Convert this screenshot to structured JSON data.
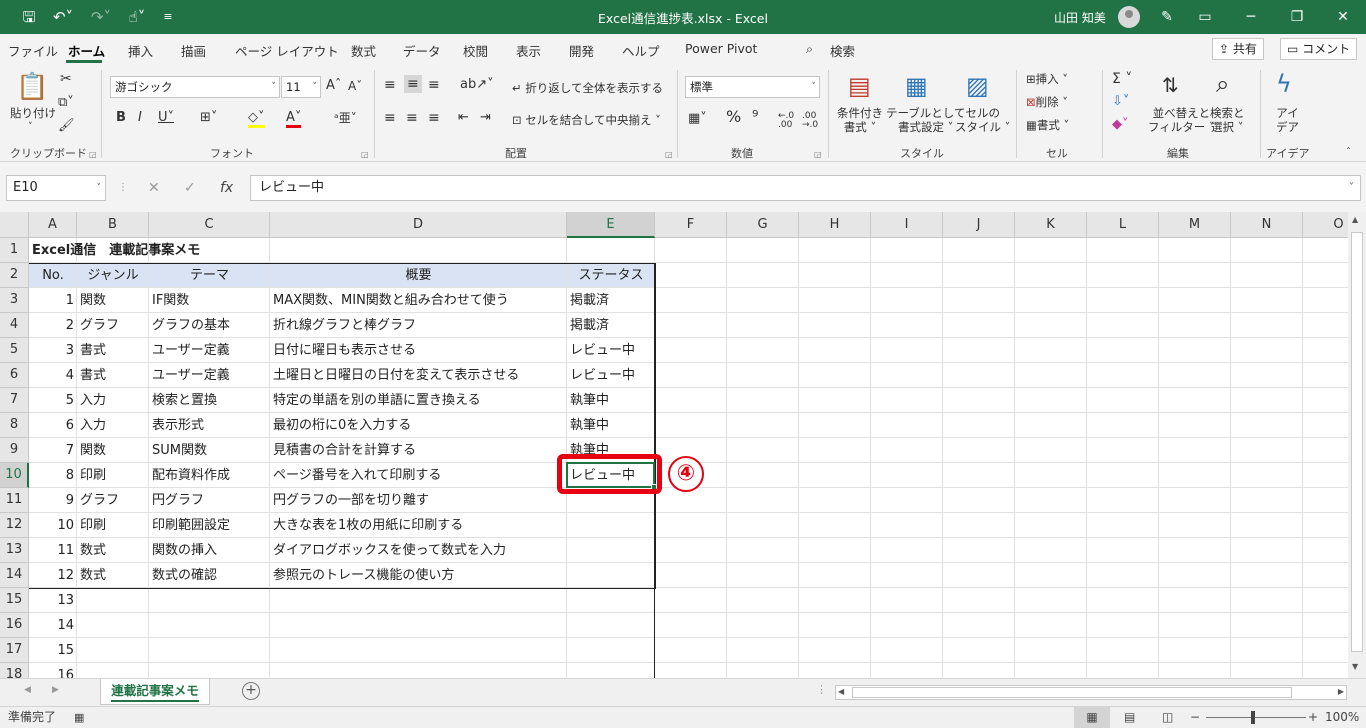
{
  "titlebar": {
    "title": "Excel通信進捗表.xlsx  -  Excel",
    "user": "山田 知美",
    "minimize": "─",
    "restore": "❐",
    "close": "✕"
  },
  "menu": {
    "tabs": [
      "ファイル",
      "ホーム",
      "挿入",
      "描画",
      "ページ レイアウト",
      "数式",
      "データ",
      "校閲",
      "表示",
      "開発",
      "ヘルプ",
      "Power Pivot",
      "検索"
    ],
    "share": "共有",
    "comment": "コメント"
  },
  "ribbon": {
    "clipboard": {
      "paste": "貼り付け",
      "label": "クリップボード"
    },
    "font": {
      "name": "游ゴシック",
      "size": "11",
      "label": "フォント"
    },
    "alignment": {
      "wrap": "折り返して全体を表示する",
      "merge": "セルを結合して中央揃え",
      "label": "配置"
    },
    "number": {
      "format": "標準",
      "label": "数値"
    },
    "styles": {
      "cond1": "条件付き",
      "cond2": "書式",
      "table1": "テーブルとして",
      "table2": "書式設定",
      "cell1": "セルの",
      "cell2": "スタイル",
      "label": "スタイル"
    },
    "cells": {
      "insert": "挿入",
      "delete": "削除",
      "format": "書式",
      "label": "セル"
    },
    "editing": {
      "sort1": "並べ替えと",
      "sort2": "フィルター",
      "find1": "検索と",
      "find2": "選択",
      "label": "編集"
    },
    "ideas": {
      "l1": "アイ",
      "l2": "デア",
      "label": "アイデア"
    }
  },
  "formula_bar": {
    "name_box": "E10",
    "content": "レビュー中"
  },
  "columns": [
    "A",
    "B",
    "C",
    "D",
    "E",
    "F",
    "G",
    "H",
    "I",
    "J",
    "K",
    "L",
    "M",
    "N",
    "O"
  ],
  "rows": [
    "1",
    "2",
    "3",
    "4",
    "5",
    "6",
    "7",
    "8",
    "9",
    "10",
    "11",
    "12",
    "13",
    "14",
    "15",
    "16",
    "17",
    "18"
  ],
  "sheet": {
    "title": "Excel通信　連載記事案メモ",
    "headers": [
      "No.",
      "ジャンル",
      "テーマ",
      "概要",
      "ステータス"
    ],
    "records": [
      [
        "1",
        "関数",
        "IF関数",
        "MAX関数、MIN関数と組み合わせて使う",
        "掲載済"
      ],
      [
        "2",
        "グラフ",
        "グラフの基本",
        "折れ線グラフと棒グラフ",
        "掲載済"
      ],
      [
        "3",
        "書式",
        "ユーザー定義",
        "日付に曜日も表示させる",
        "レビュー中"
      ],
      [
        "4",
        "書式",
        "ユーザー定義",
        "土曜日と日曜日の日付を変えて表示させる",
        "レビュー中"
      ],
      [
        "5",
        "入力",
        "検索と置換",
        "特定の単語を別の単語に置き換える",
        "執筆中"
      ],
      [
        "6",
        "入力",
        "表示形式",
        "最初の桁に0を入力する",
        "執筆中"
      ],
      [
        "7",
        "関数",
        "SUM関数",
        "見積書の合計を計算する",
        "執筆中"
      ],
      [
        "8",
        "印刷",
        "配布資料作成",
        "ページ番号を入れて印刷する",
        "レビュー中"
      ],
      [
        "9",
        "グラフ",
        "円グラフ",
        "円グラフの一部を切り離す",
        ""
      ],
      [
        "10",
        "印刷",
        "印刷範囲設定",
        "大きな表を1枚の用紙に印刷する",
        ""
      ],
      [
        "11",
        "数式",
        "関数の挿入",
        "ダイアログボックスを使って数式を入力",
        ""
      ],
      [
        "12",
        "数式",
        "数式の確認",
        "参照元のトレース機能の使い方",
        ""
      ],
      [
        "13",
        "",
        "",
        "",
        ""
      ],
      [
        "14",
        "",
        "",
        "",
        ""
      ],
      [
        "15",
        "",
        "",
        "",
        ""
      ],
      [
        "16",
        "",
        "",
        "",
        ""
      ]
    ]
  },
  "annotation": "④",
  "sheet_tab": "連載記事案メモ",
  "status": {
    "ready": "準備完了",
    "zoom": "100%"
  }
}
